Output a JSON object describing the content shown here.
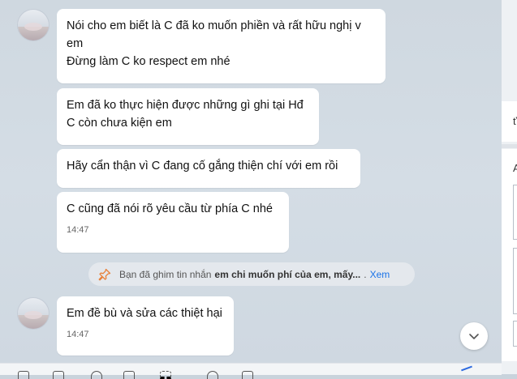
{
  "messages": [
    {
      "lines": [
        "Nói cho em biết là C đã ko muốn phiền và rất hữu nghị v",
        "em",
        "Đừng làm C ko respect em nhé"
      ]
    },
    {
      "lines": [
        "Em đã ko thực hiện được những gì ghi tại Hđ",
        "C còn chưa kiện em"
      ]
    },
    {
      "lines": [
        "Hãy cẩn thận vì C đang cố gắng thiện chí với em rồi"
      ]
    },
    {
      "lines": [
        "C cũng đã nói rõ yêu cầu từ phía C nhé"
      ],
      "time": "14:47"
    },
    {
      "lines": [
        "Em đề bù và sửa các thiệt hại"
      ],
      "time": "14:47"
    }
  ],
  "pin_notice": {
    "prefix": "Bạn đã ghim tin nhắn",
    "message": "em chi muốn phí của em, mấy...",
    "dot": ".",
    "view_label": "Xem"
  },
  "right_panel": {
    "char1": "ť",
    "char2": "A"
  },
  "icons": {
    "pin": "pin-icon",
    "scroll": "chevron-down-icon"
  },
  "colors": {
    "link": "#1a73e8",
    "pin": "#e8813a"
  }
}
